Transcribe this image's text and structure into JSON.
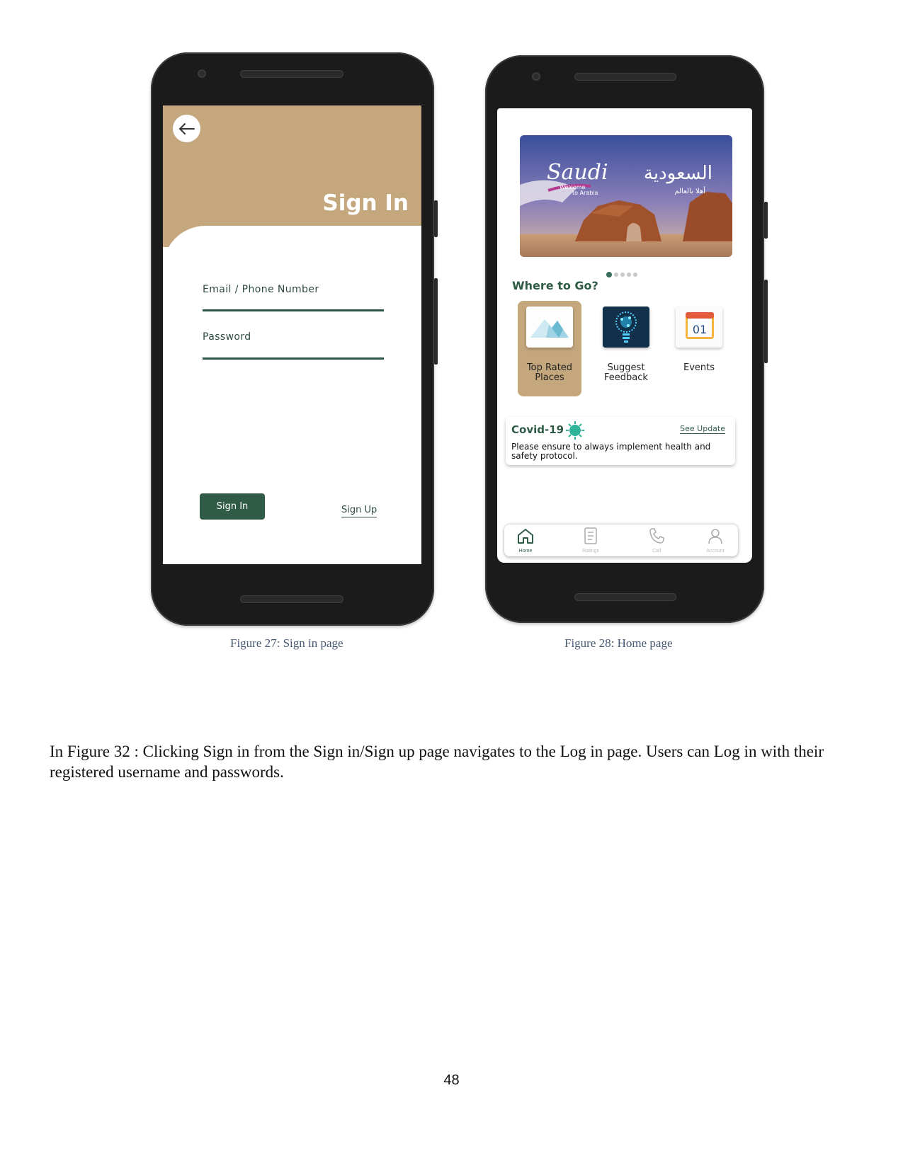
{
  "signin_screen": {
    "title": "Sign In",
    "email_label": "Email / Phone Number",
    "password_label": "Password",
    "signin_button": "Sign In",
    "signup_link": "Sign Up",
    "colors": {
      "banner": "#c4a77d",
      "accent": "#2f5b47"
    }
  },
  "home_screen": {
    "hero": {
      "logo_text": "Saudi",
      "tagline_line1": "Welcome",
      "tagline_line2": "to Arabia",
      "arabic_title": "السعودية",
      "arabic_subtitle": "أهلا بالعالم"
    },
    "carousel_pages": 5,
    "carousel_active": 1,
    "section_title": "Where to Go?",
    "categories": [
      {
        "label_line1": "Top Rated",
        "label_line2": "Places",
        "icon": "mountain-icon",
        "selected": true
      },
      {
        "label_line1": "Suggest",
        "label_line2": "Feedback",
        "icon": "lightbulb-icon",
        "selected": false
      },
      {
        "label_line1": "Events",
        "label_line2": "",
        "icon": "calendar-icon",
        "selected": false,
        "calendar_day": "01"
      }
    ],
    "covid_card": {
      "title": "Covid-19",
      "link": "See Update",
      "text": "Please ensure to always implement health and safety protocol."
    },
    "tabs": [
      {
        "label": "Home",
        "icon": "home-icon",
        "active": true
      },
      {
        "label": "Ratings",
        "icon": "document-icon",
        "active": false
      },
      {
        "label": "Call",
        "icon": "phone-icon",
        "active": false
      },
      {
        "label": "Account",
        "icon": "user-icon",
        "active": false
      }
    ]
  },
  "captions": {
    "fig27": "Figure 27: Sign in page",
    "fig28": "Figure 28: Home page"
  },
  "paragraph": "In Figure 32 : Clicking Sign in from the Sign in/Sign up page navigates to the Log in page. Users can Log in with their registered username and passwords.",
  "page_number": "48"
}
